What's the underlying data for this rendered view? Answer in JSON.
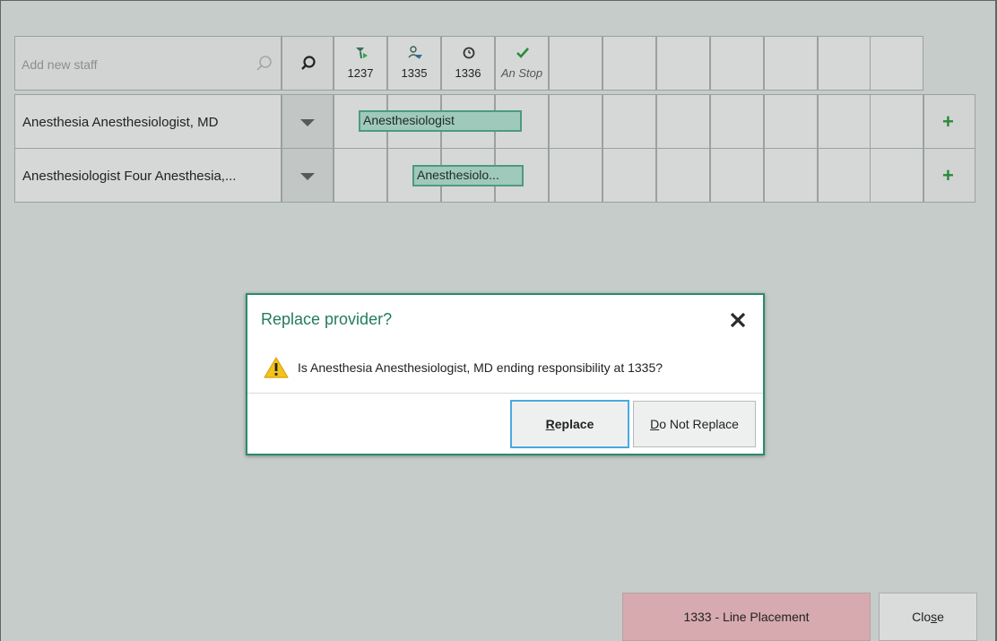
{
  "staff_search": {
    "placeholder": "Add new staff",
    "search_icon": "magnifier-icon"
  },
  "timeline_header": [
    {
      "icon": "anesthesia-start-flag-icon",
      "label": "1237",
      "italic": false
    },
    {
      "icon": "person-transfer-icon",
      "label": "1335",
      "italic": false
    },
    {
      "icon": "clock-icon",
      "label": "1336",
      "italic": false
    },
    {
      "icon": "checkmark-icon",
      "label": "An Stop",
      "italic": true
    }
  ],
  "staff_rows": [
    {
      "name": "Anesthesia Anesthesiologist, MD",
      "role": "Anesthesiologist"
    },
    {
      "name": "Anesthesiologist Four Anesthesia,...",
      "role": "Anesthesiolo..."
    }
  ],
  "dialog": {
    "title": "Replace provider?",
    "message": "Is Anesthesia Anesthesiologist, MD ending responsibility at 1335?",
    "replace_accesskey": "R",
    "replace_rest": "eplace",
    "dnr_accesskey": "D",
    "dnr_rest": "o Not Replace",
    "icon": "warning-icon"
  },
  "footer": {
    "event_button": "1333 - Line Placement",
    "close_pre": "Clo",
    "close_accesskey": "s",
    "close_post": "e"
  },
  "colors": {
    "accent": "#2b8a6d",
    "bar_fill": "#9fc9bb",
    "event_button": "#d6aaae",
    "add_green": "#2a8a3e"
  }
}
